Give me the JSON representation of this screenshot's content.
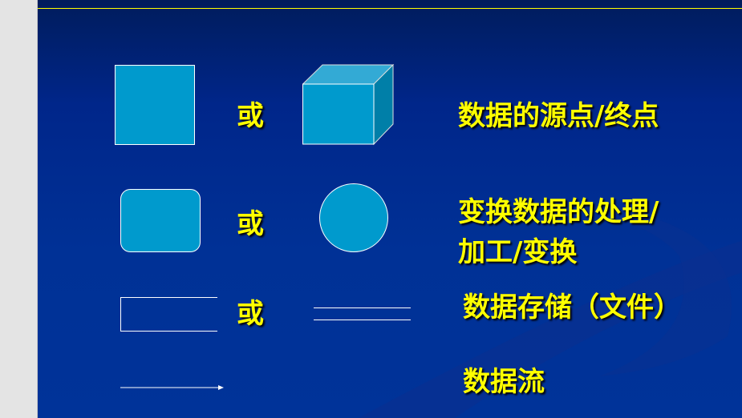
{
  "rows": [
    {
      "or": "或",
      "label": "数据的源点/终点"
    },
    {
      "or": "或",
      "label_line1": "变换数据的处理/",
      "label_line2": "加工/变换"
    },
    {
      "or": "或",
      "label": "数据存储（文件）"
    },
    {
      "label": "数据流"
    }
  ],
  "colors": {
    "background": "#003399",
    "shape_fill": "#009ACD",
    "text": "#FFFF00",
    "rule": "#FFFF00"
  }
}
